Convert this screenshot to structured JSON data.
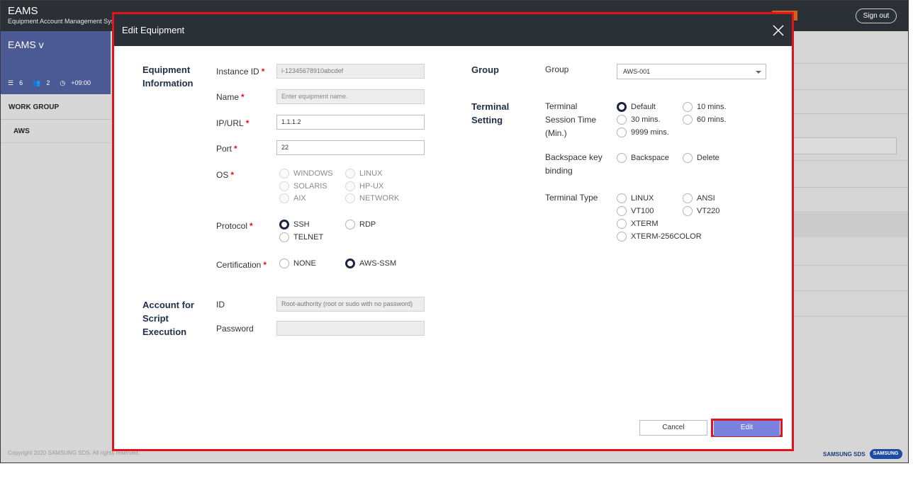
{
  "app": {
    "title": "EAMS",
    "subtitle": "Equipment Account Management System",
    "signout_label": "Sign out"
  },
  "sidebar": {
    "title": "EAMS v",
    "stats": {
      "list_count": "6",
      "user_count": "2",
      "timezone": "+09:00"
    },
    "group_header": "WORK GROUP",
    "group_item": "AWS"
  },
  "footer": {
    "copyright": "Copyright 2020 SAMSUNG SDS. All rights reserved.",
    "brand_text": "SAMSUNG SDS",
    "brand_logo": "SAMSUNG"
  },
  "modal": {
    "title": "Edit Equipment",
    "close_icon": "close-icon",
    "equipment_section": "Equipment Information",
    "fields": {
      "instance_id": {
        "label": "Instance ID",
        "value": "i-12345678910abcdef"
      },
      "name": {
        "label": "Name",
        "placeholder": "Enter equipment name."
      },
      "ip_url": {
        "label": "IP/URL",
        "value": "1.1.1.2"
      },
      "port": {
        "label": "Port",
        "value": "22"
      },
      "os": {
        "label": "OS",
        "options": [
          "WINDOWS",
          "LINUX",
          "SOLARIS",
          "HP-UX",
          "AIX",
          "NETWORK"
        ]
      },
      "protocol": {
        "label": "Protocol",
        "options": [
          "SSH",
          "RDP",
          "TELNET"
        ],
        "selected": "SSH"
      },
      "certification": {
        "label": "Certification",
        "options": [
          "NONE",
          "AWS-SSM"
        ],
        "selected": "AWS-SSM"
      }
    },
    "account_section": "Account for Script Execution",
    "account": {
      "id_label": "ID",
      "id_placeholder": "Root-authority (root or sudo with no password)",
      "password_label": "Password",
      "password_value": ""
    },
    "group_section": "Group",
    "group": {
      "label": "Group",
      "value": "AWS-001"
    },
    "terminal_section": "Terminal Setting",
    "terminal": {
      "session_label": "Terminal Session Time (Min.)",
      "session_options": [
        "Default",
        "10 mins.",
        "30 mins.",
        "60 mins.",
        "9999 mins."
      ],
      "session_selected": "Default",
      "backspace_label": "Backspace key binding",
      "backspace_options": [
        "Backspace",
        "Delete"
      ],
      "type_label": "Terminal Type",
      "type_options": [
        "LINUX",
        "ANSI",
        "VT100",
        "VT220",
        "XTERM",
        "XTERM-256COLOR"
      ]
    },
    "buttons": {
      "cancel": "Cancel",
      "edit": "Edit"
    },
    "colors": {
      "header": "#2b2f36",
      "highlight": "#e0141a",
      "primary": "#7a82e0",
      "required": "#e0141a"
    }
  }
}
